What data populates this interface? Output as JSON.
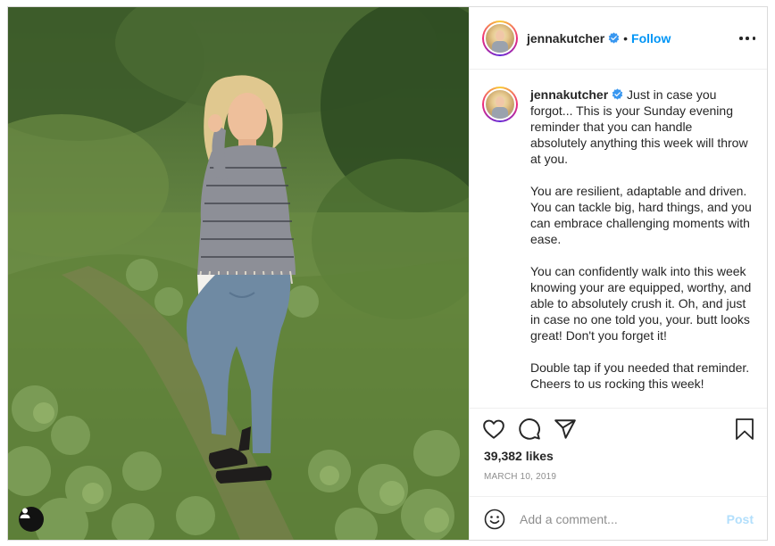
{
  "post": {
    "username": "jennakutcher",
    "verified_icon": "verified-badge-icon",
    "separator": "•",
    "follow_label": "Follow",
    "more_icon": "more-options-icon",
    "caption": {
      "username": "jennakutcher",
      "paragraphs": [
        "Just in case you forgot... This is your Sunday evening reminder that you can handle absolutely anything this week will throw at you.",
        "You are resilient, adaptable and driven. You can tackle big, hard things, and you can embrace challenging moments with ease.",
        "You can confidently walk into this week knowing your are equipped, worthy, and able to absolutely crush it. Oh, and just in case no one told you, your. butt looks great! Don't you forget it!",
        "Double tap if you needed that reminder. Cheers to us rocking this week!"
      ]
    },
    "actions": {
      "like_icon": "heart-icon",
      "comment_icon": "comment-bubble-icon",
      "share_icon": "paper-plane-icon",
      "save_icon": "bookmark-icon"
    },
    "likes": "39,382 likes",
    "date": "MARCH 10, 2019",
    "comment": {
      "emoji_icon": "emoji-icon",
      "placeholder": "Add a comment...",
      "post_label": "Post"
    },
    "photo": {
      "user_tag_icon": "user-tag-icon"
    }
  },
  "colors": {
    "accent": "#0095f6",
    "post_disabled": "#b2dffc",
    "text": "#262626",
    "muted": "#8e8e8e",
    "border": "#dbdbdb"
  }
}
